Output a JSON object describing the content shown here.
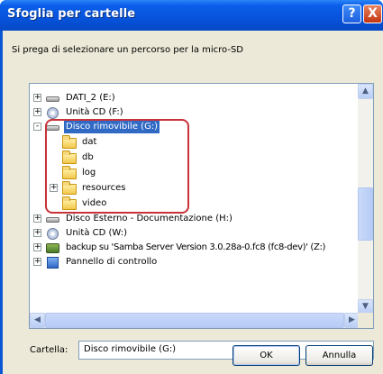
{
  "window": {
    "title": "Sfoglia per cartelle"
  },
  "titlebar_buttons": {
    "help": "?",
    "close": "X"
  },
  "prompt": "Si prega di selezionare un percorso per la micro-SD",
  "tree": {
    "items": [
      {
        "label": "DATI_2 (E:)",
        "expander": "+",
        "icon": "drive-icon"
      },
      {
        "label": "Unità CD (F:)",
        "expander": "+",
        "icon": "cd-drive-icon"
      },
      {
        "label": "Disco rimovibile (G:)",
        "expander": "-",
        "icon": "removable-drive-icon",
        "selected": true
      },
      {
        "label": "dat",
        "icon": "folder-icon"
      },
      {
        "label": "db",
        "icon": "folder-icon"
      },
      {
        "label": "log",
        "icon": "folder-icon"
      },
      {
        "label": "resources",
        "expander": "+",
        "icon": "folder-icon"
      },
      {
        "label": "video",
        "icon": "folder-icon"
      },
      {
        "label": "Disco Esterno - Documentazione (H:)",
        "expander": "+",
        "icon": "drive-icon"
      },
      {
        "label": "Unità CD (W:)",
        "expander": "+",
        "icon": "cd-drive-icon"
      },
      {
        "label": "backup su 'Samba Server Version 3.0.28a-0.fc8 (fc8-dev)' (Z:)",
        "expander": "+",
        "icon": "network-drive-icon"
      },
      {
        "label": "Pannello di controllo",
        "expander": "+",
        "icon": "control-panel-icon"
      }
    ]
  },
  "folder": {
    "label": "Cartella:",
    "value": "Disco rimovibile (G:)"
  },
  "buttons": {
    "ok": "OK",
    "cancel": "Annulla"
  },
  "scrollbar_glyphs": {
    "up": "▲",
    "down": "▼",
    "left": "◀",
    "right": "▶"
  },
  "colors": {
    "titlebar": "#0753db",
    "selection": "#316ac5",
    "highlight_outline": "#c8323a"
  }
}
